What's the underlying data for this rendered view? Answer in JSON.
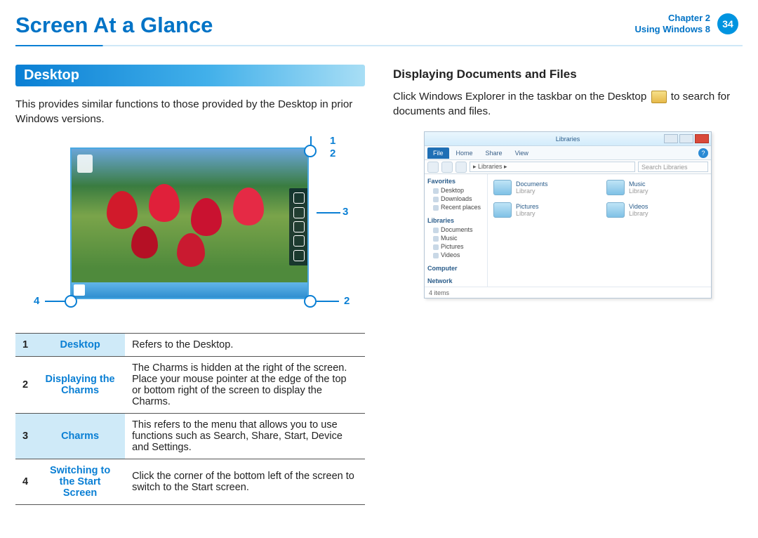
{
  "header": {
    "title": "Screen At a Glance",
    "chapter_line1": "Chapter 2",
    "chapter_line2": "Using Windows 8",
    "page_number": "34"
  },
  "left": {
    "section_title": "Desktop",
    "intro": "This provides similar functions to those provided by the Desktop in prior Windows versions.",
    "callouts": {
      "c1": "1",
      "c2": "2",
      "c3": "3",
      "c4": "4"
    },
    "table": [
      {
        "num": "1",
        "term": "Desktop",
        "desc": "Refers to the Desktop."
      },
      {
        "num": "2",
        "term": "Displaying the Charms",
        "desc": "The Charms is hidden at the right of the screen. Place your mouse pointer at the edge of the top or bottom right of the screen to display the Charms."
      },
      {
        "num": "3",
        "term": "Charms",
        "desc": "This refers to the menu that allows you to use functions such as Search, Share, Start, Device and Settings."
      },
      {
        "num": "4",
        "term": "Switching to the Start Screen",
        "desc": "Click the corner of the bottom left of the screen to switch to the Start screen."
      }
    ]
  },
  "right": {
    "subhead": "Displaying Documents and Files",
    "para_before": "Click Windows Explorer in the taskbar on the Desktop ",
    "para_after": " to search for documents and files.",
    "explorer": {
      "title": "Libraries",
      "tabs": {
        "file": "File",
        "home": "Home",
        "share": "Share",
        "view": "View"
      },
      "address": "▸ Libraries ▸",
      "search_placeholder": "Search Libraries",
      "nav": {
        "favorites": "Favorites",
        "fav_items": [
          "Desktop",
          "Downloads",
          "Recent places"
        ],
        "libraries": "Libraries",
        "lib_items": [
          "Documents",
          "Music",
          "Pictures",
          "Videos"
        ],
        "computer": "Computer",
        "network": "Network"
      },
      "libs": [
        {
          "name": "Documents",
          "sub": "Library"
        },
        {
          "name": "Music",
          "sub": "Library"
        },
        {
          "name": "Pictures",
          "sub": "Library"
        },
        {
          "name": "Videos",
          "sub": "Library"
        }
      ],
      "status": "4 items"
    }
  }
}
